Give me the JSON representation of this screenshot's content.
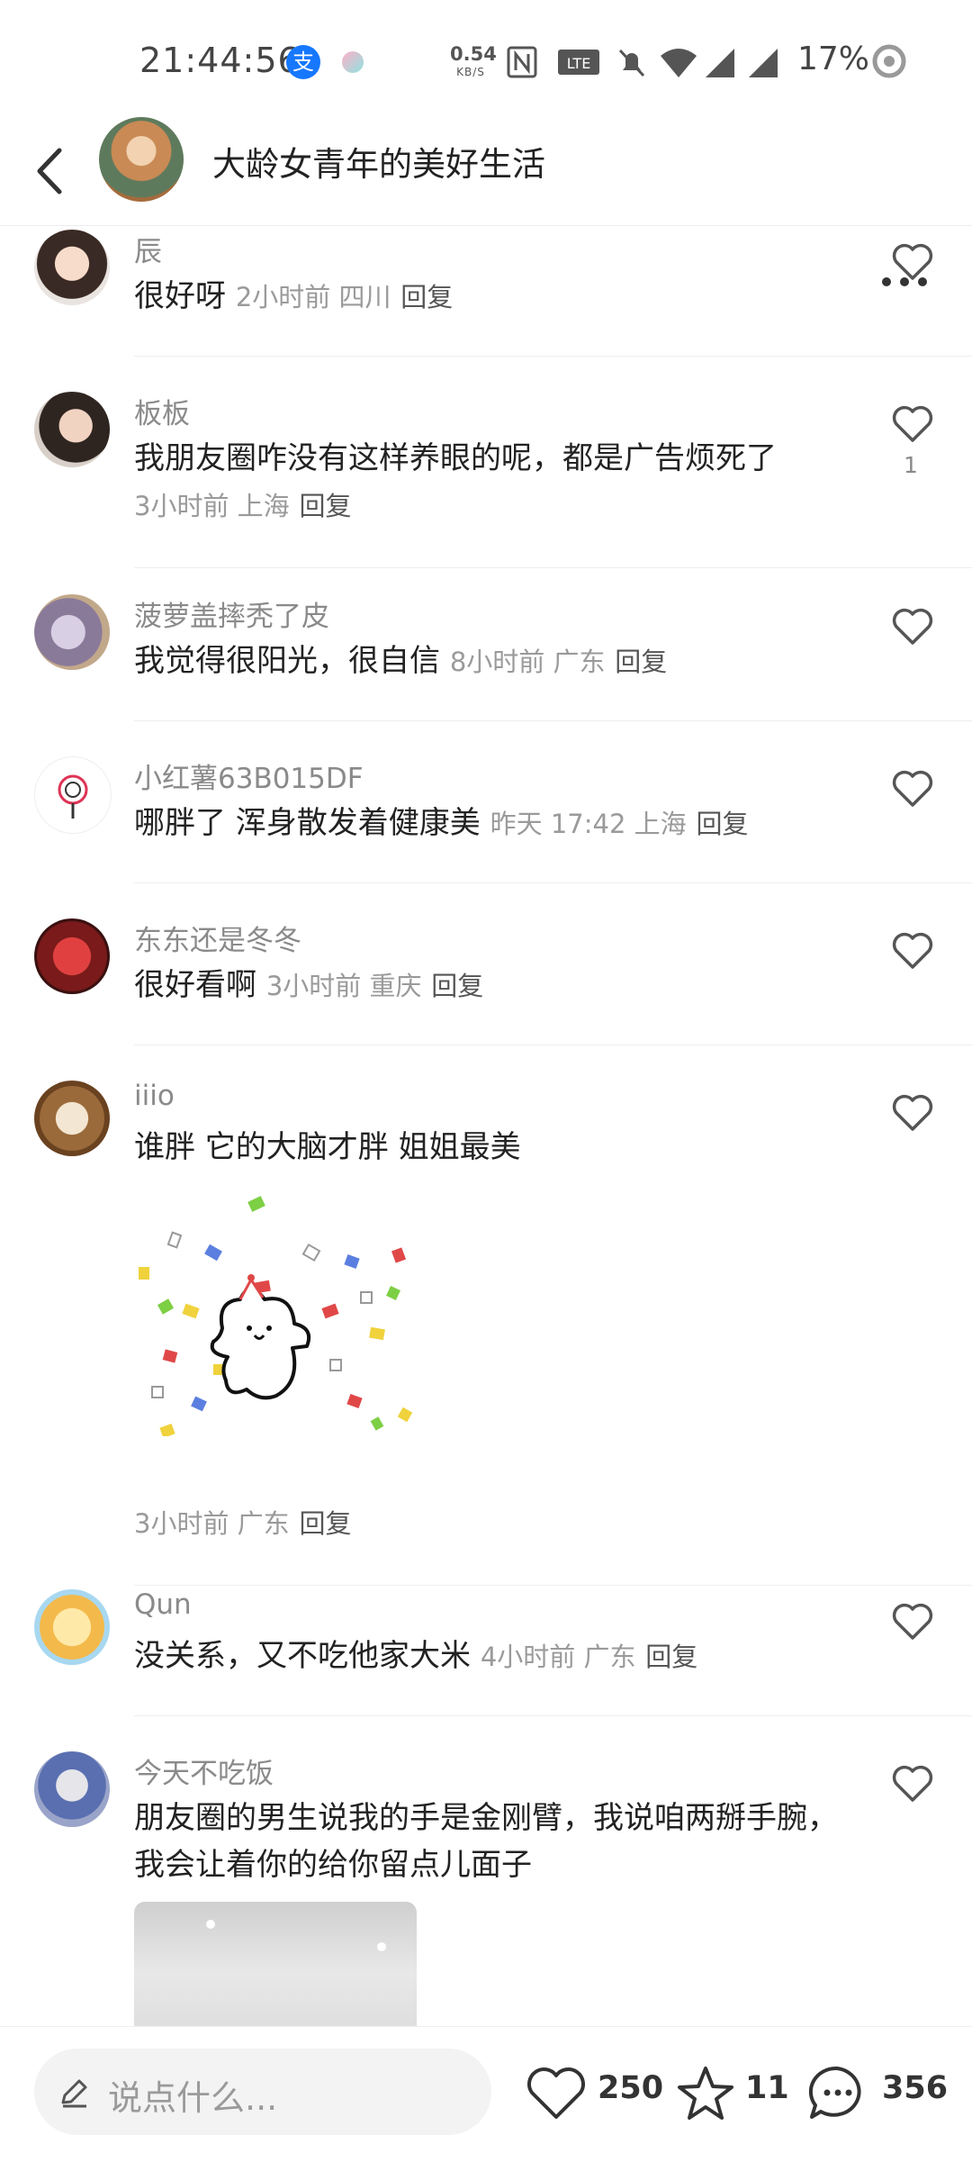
{
  "status_bar": {
    "time": "21:44:56",
    "app_badge": "支",
    "net_speed": "0.54",
    "net_unit": "KB/S",
    "battery": "17%"
  },
  "header": {
    "title": "大龄女青年的美好生活"
  },
  "comments": [
    {
      "user": "辰",
      "text": "很好呀",
      "meta": "2小时前  四川",
      "reply": "回复",
      "likes": ""
    },
    {
      "user": "板板",
      "text": "我朋友圈咋没有这样养眼的呢，都是广告烦死了",
      "meta": "3小时前  上海",
      "reply": "回复",
      "likes": "1"
    },
    {
      "user": "菠萝盖摔秃了皮",
      "text": "我觉得很阳光，很自信",
      "meta": "8小时前  广东",
      "reply": "回复",
      "likes": ""
    },
    {
      "user": "小红薯63B015DF",
      "text": "哪胖了 浑身散发着健康美",
      "meta": "昨天 17:42 上海",
      "reply": "回复",
      "likes": ""
    },
    {
      "user": "东东还是冬冬",
      "text": "很好看啊",
      "meta": "3小时前  重庆",
      "reply": "回复",
      "likes": ""
    },
    {
      "user": "iiio",
      "text": "谁胖 它的大脑才胖 姐姐最美",
      "meta": "3小时前  广东",
      "reply": "回复",
      "likes": ""
    },
    {
      "user": "Qun",
      "text": "没关系，又不吃他家大米",
      "meta": "4小时前  广东",
      "reply": "回复",
      "likes": ""
    },
    {
      "user": "今天不吃饭",
      "text": "朋友圈的男生说我的手是金刚臂，我说咱两掰手腕，我会让着你的给你留点儿面子",
      "meta": "",
      "reply": "",
      "likes": ""
    }
  ],
  "bottom_bar": {
    "placeholder": "说点什么...",
    "likes": "250",
    "stars": "11",
    "comments": "356"
  },
  "colors": {
    "text_primary": "#222222",
    "text_secondary": "#9a9a9a",
    "accent_blue": "#1677ff"
  }
}
